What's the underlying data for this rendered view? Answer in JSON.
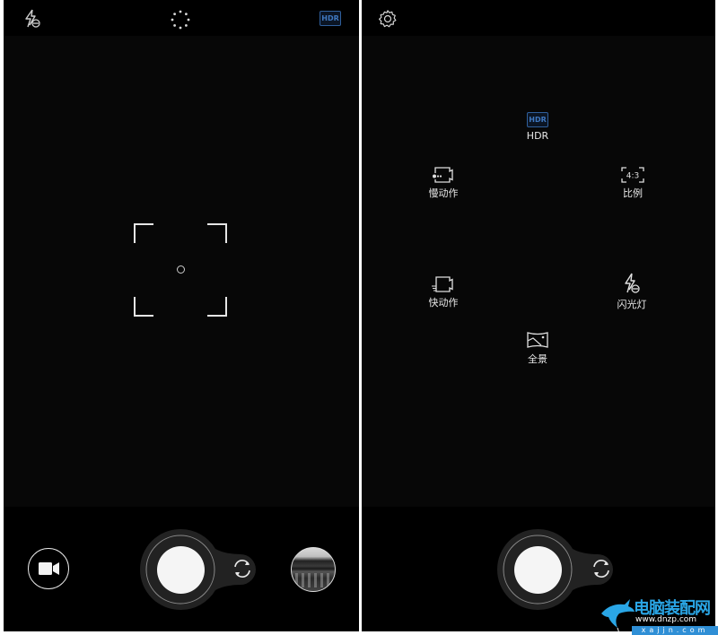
{
  "left_screen": {
    "topbar": {
      "flash_icon": "flash-off-icon",
      "center_icon": "live-photo-icon",
      "hdr_badge": "HDR"
    },
    "focus": {
      "icon": "focus-frame-icon"
    },
    "bottombar": {
      "video_button_icon": "video-camera-icon",
      "shutter_icon": "shutter-button",
      "switch_camera_icon": "switch-camera-icon",
      "thumbnail": "gallery-thumbnail"
    }
  },
  "right_screen": {
    "topbar": {
      "settings_icon": "gear-icon"
    },
    "modes": [
      {
        "id": "hdr",
        "label": "HDR",
        "icon": "hdr-icon",
        "badge": "HDR",
        "active": true
      },
      {
        "id": "slow-motion",
        "label": "慢动作",
        "icon": "slow-motion-icon"
      },
      {
        "id": "aspect-ratio",
        "label": "比例",
        "icon": "aspect-ratio-icon",
        "badge": "4:3"
      },
      {
        "id": "time-lapse",
        "label": "快动作",
        "icon": "time-lapse-icon"
      },
      {
        "id": "flash",
        "label": "闪光灯",
        "icon": "flash-off-icon"
      },
      {
        "id": "panorama",
        "label": "全景",
        "icon": "panorama-icon"
      }
    ],
    "bottombar": {
      "shutter_icon": "shutter-button",
      "switch_camera_icon": "switch-camera-icon"
    }
  },
  "watermark": {
    "title": "电脑装配网",
    "url": "www.dnzp.com",
    "url2": "xajjn.com"
  },
  "colors": {
    "accent_hdr": "#3f78c0",
    "background": "#000000",
    "watermark_blue": "#2aa6e6"
  }
}
